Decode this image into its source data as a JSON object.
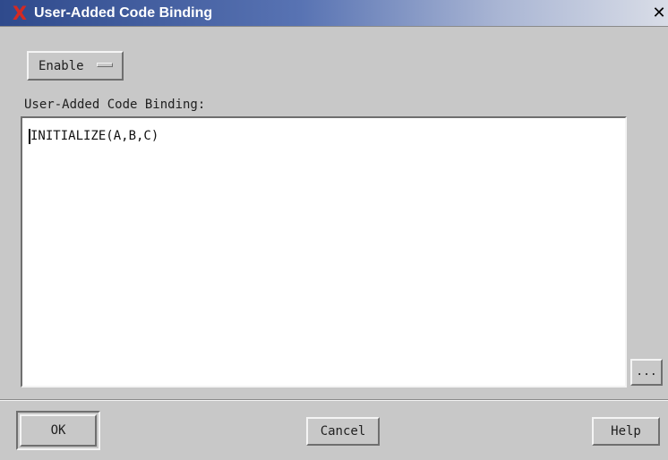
{
  "window": {
    "title": "User-Added Code Binding",
    "close_icon": "close-icon",
    "close_glyph": "✕",
    "logo_icon": "x-logo-icon",
    "logo_glyph": "X"
  },
  "option_menu": {
    "selected": "Enable"
  },
  "field": {
    "label": "User-Added Code Binding:",
    "value": "INITIALIZE(A,B,C)"
  },
  "ellipsis_button": {
    "label": "..."
  },
  "buttons": {
    "ok": "OK",
    "cancel": "Cancel",
    "help": "Help"
  }
}
